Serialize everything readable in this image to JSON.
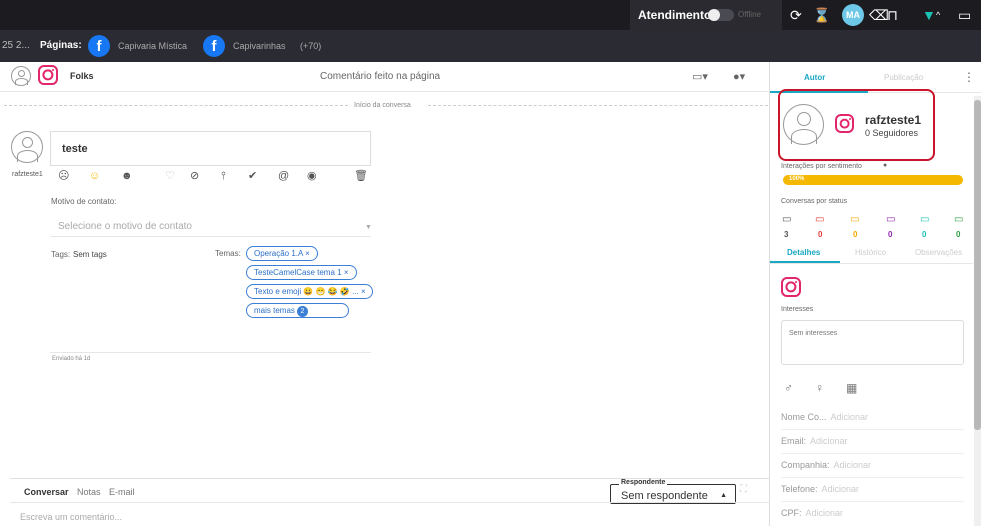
{
  "topbar": {
    "atendimento_label": "Atendimento",
    "toggle_text": "Offline",
    "avatar_initials": "MA",
    "icons": [
      "refresh-icon",
      "hourglass-icon",
      "eraser-icon",
      "presentation-icon",
      "filter-icon",
      "chevron-up-icon",
      "feedback-icon"
    ],
    "filter_color": "#19c2b5"
  },
  "pagesbar": {
    "count": "25 2...",
    "label": "Páginas:",
    "pages": [
      {
        "name": "Capivaria Mística"
      },
      {
        "name": "Capivarinhas"
      }
    ],
    "more": "(+70)"
  },
  "conversation": {
    "header": {
      "account_name": "Folks",
      "title": "Comentário feito na página"
    },
    "divider_text": "Início da conversa",
    "message": {
      "text": "teste",
      "sender": "rafzteste1",
      "sent_ago": "Enviado há 1d"
    },
    "motivo_label": "Motivo de contato:",
    "motivo_placeholder": "Selecione o motivo de contato",
    "tags_label": "Tags:",
    "tags_value": "Sem tags",
    "temas_label": "Temas:",
    "temas": [
      "Operação 1.A ×",
      "TesteCamelCase tema 1 ×",
      "Texto e emoji 😀 😁 😂 🤣 ...  ×"
    ],
    "more_temas_label": "mais temas",
    "more_temas_count": "2"
  },
  "composer": {
    "tabs": [
      "Conversar",
      "Notas",
      "E-mail"
    ],
    "respondente_label": "Respondente",
    "respondente_value": "Sem respondente",
    "placeholder": "Escreva um comentário..."
  },
  "profile": {
    "tabs": [
      "Autor",
      "Publicação"
    ],
    "username": "rafzteste1",
    "followers": "0 Seguidores",
    "sentiment_label": "Interações por sentimento",
    "sentiment_percent": "100%",
    "sentiment_fraction": 1.0,
    "status_label": "Conversas por status",
    "status": [
      {
        "count": "3",
        "color": "#555555"
      },
      {
        "count": "0",
        "color": "#e53935"
      },
      {
        "count": "0",
        "color": "#f5a800"
      },
      {
        "count": "0",
        "color": "#8e24aa"
      },
      {
        "count": "0",
        "color": "#19c2b5"
      },
      {
        "count": "0",
        "color": "#2e9e44"
      }
    ],
    "subtabs": [
      "Detalhes",
      "Histórico",
      "Observações"
    ],
    "interests_label": "Interesses",
    "interests_placeholder": "Sem interesses",
    "fields": [
      {
        "label": "Nome Co...",
        "action": "Adicionar"
      },
      {
        "label": "Email:",
        "action": "Adicionar"
      },
      {
        "label": "Companhia:",
        "action": "Adicionar"
      },
      {
        "label": "Telefone:",
        "action": "Adicionar"
      },
      {
        "label": "CPF:",
        "action": "Adicionar"
      }
    ],
    "highlight_color": "#c9152b"
  }
}
